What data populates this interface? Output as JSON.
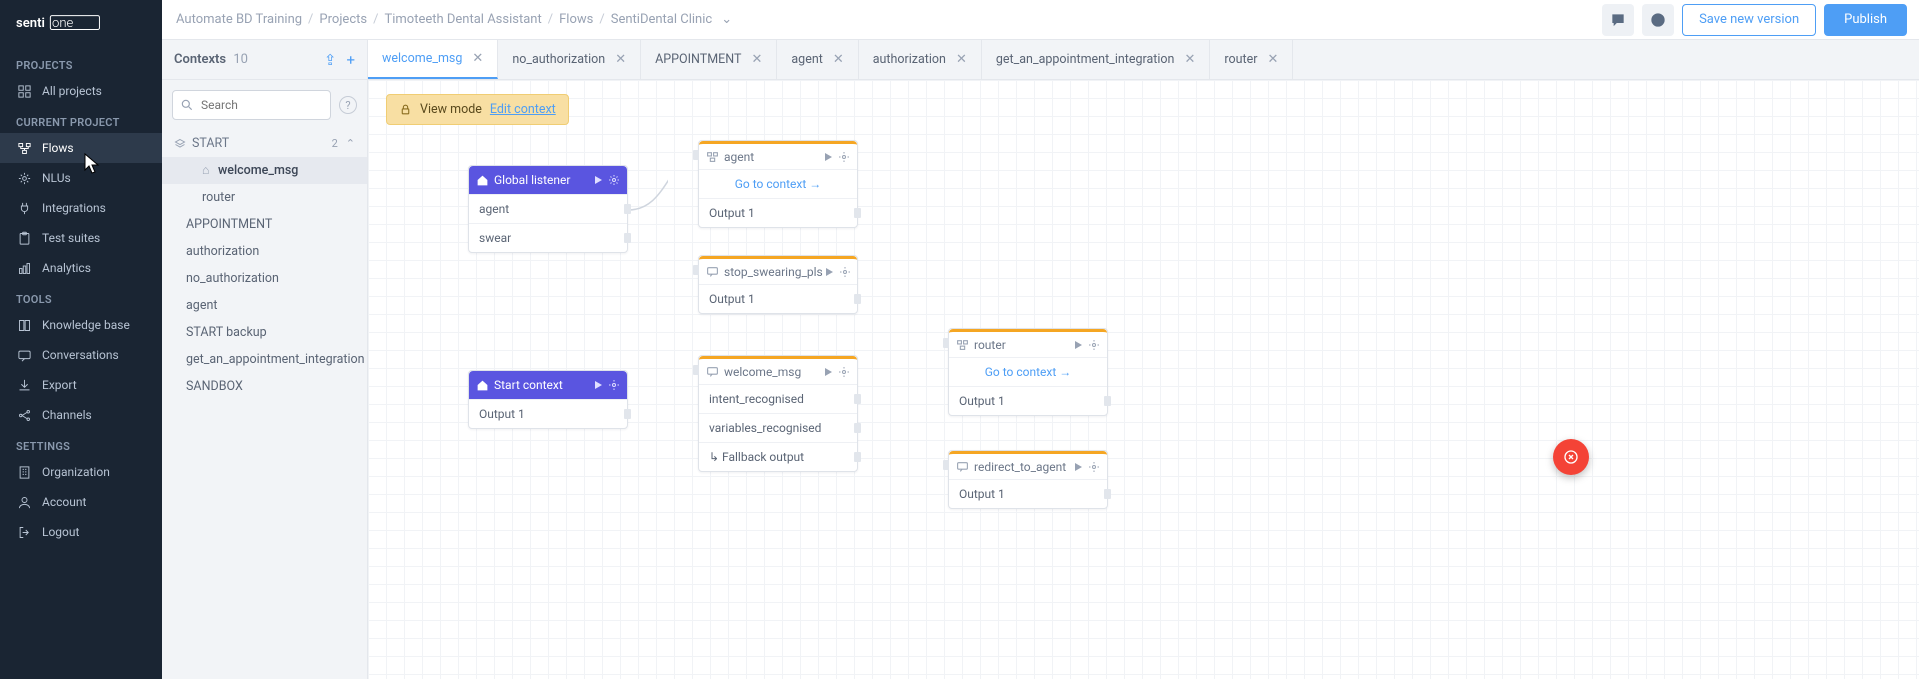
{
  "logo_text": "sentione",
  "sidebar": {
    "sections": {
      "projects": "PROJECTS",
      "current_project": "CURRENT PROJECT",
      "tools": "TOOLS",
      "settings": "SETTINGS"
    },
    "items": {
      "all_projects": "All projects",
      "flows": "Flows",
      "nlus": "NLUs",
      "integrations": "Integrations",
      "test_suites": "Test suites",
      "analytics": "Analytics",
      "knowledge_base": "Knowledge base",
      "conversations": "Conversations",
      "export": "Export",
      "channels": "Channels",
      "organization": "Organization",
      "account": "Account",
      "logout": "Logout"
    }
  },
  "breadcrumb": [
    "Automate BD Training",
    "Projects",
    "Timoteeth Dental Assistant",
    "Flows",
    "SentiDental Clinic"
  ],
  "buttons": {
    "save": "Save new version",
    "publish": "Publish"
  },
  "contexts": {
    "title": "Contexts",
    "count": "10",
    "search_placeholder": "Search",
    "groups": {
      "start": {
        "name": "START",
        "count": "2"
      }
    },
    "items": {
      "welcome_msg": "welcome_msg",
      "router": "router",
      "appointment": "APPOINTMENT",
      "authorization": "authorization",
      "no_authorization": "no_authorization",
      "agent": "agent",
      "start_backup": "START backup",
      "get_appt": "get_an_appointment_integration",
      "sandbox": "SANDBOX"
    }
  },
  "tabs": [
    "welcome_msg",
    "no_authorization",
    "APPOINTMENT",
    "agent",
    "authorization",
    "get_an_appointment_integration",
    "router"
  ],
  "view_mode": {
    "label": "View mode",
    "link": "Edit context"
  },
  "nodes": {
    "global_listener": {
      "title": "Global listener",
      "rows": [
        "agent",
        "swear"
      ]
    },
    "start_context": {
      "title": "Start context",
      "rows": [
        "Output 1"
      ]
    },
    "agent": {
      "title": "agent",
      "link": "Go to context",
      "rows": [
        "Output 1"
      ]
    },
    "stop_swearing": {
      "title": "stop_swearing_pls",
      "rows": [
        "Output 1"
      ]
    },
    "welcome_msg": {
      "title": "welcome_msg",
      "rows": [
        "intent_recognised",
        "variables_recognised",
        "Fallback output"
      ]
    },
    "router": {
      "title": "router",
      "link": "Go to context",
      "rows": [
        "Output 1"
      ]
    },
    "redirect": {
      "title": "redirect_to_agent",
      "rows": [
        "Output 1"
      ]
    }
  }
}
